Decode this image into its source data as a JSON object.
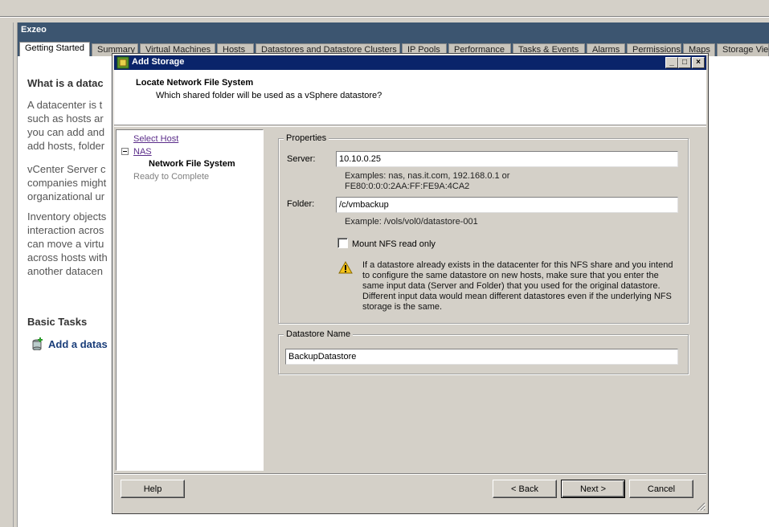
{
  "background": {
    "title": "Exzeo",
    "tabs": [
      "Getting Started",
      "Summary",
      "Virtual Machines",
      "Hosts",
      "Datastores and Datastore Clusters",
      "IP Pools",
      "Performance",
      "Tasks & Events",
      "Alarms",
      "Permissions",
      "Maps",
      "Storage Views"
    ],
    "heading": "What is a datac",
    "para1": [
      "A datacenter is t",
      "such as hosts ar",
      "you can add and",
      "add hosts, folder"
    ],
    "para2": [
      "vCenter Server c",
      "companies might",
      "organizational ur"
    ],
    "para3": [
      "Inventory objects",
      "interaction acros",
      "can move a virtu",
      "across hosts with",
      "another datacen"
    ],
    "basic_tasks": "Basic Tasks",
    "task_add": "Add a datas"
  },
  "dialog": {
    "title": "Add Storage",
    "header_title": "Locate Network File System",
    "header_subtitle": "Which shared folder will be used as a vSphere datastore?",
    "steps": {
      "select_host": "Select Host",
      "nas": "NAS",
      "nfs": "Network File System",
      "ready": "Ready to Complete"
    },
    "properties": {
      "legend": "Properties",
      "server_label": "Server:",
      "server_value": "10.10.0.25",
      "server_hint_1": "Examples: nas, nas.it.com, 192.168.0.1 or",
      "server_hint_2": "FE80:0:0:0:2AA:FF:FE9A:4CA2",
      "folder_label": "Folder:",
      "folder_value": "/c/vmbackup",
      "folder_hint": "Example: /vols/vol0/datastore-001",
      "mount_ro": "Mount NFS read only",
      "warning_1": "If a datastore already exists in the datacenter for this NFS share and you intend",
      "warning_2": "to configure the same datastore on new hosts, make sure that you enter the",
      "warning_3": "same input data (Server and Folder) that you used for the original datastore.",
      "warning_4": "Different input data would mean different datastores even if the underlying NFS",
      "warning_5": "storage is the same."
    },
    "datastore": {
      "legend": "Datastore Name",
      "value": "BackupDatastore"
    },
    "buttons": {
      "help": "Help",
      "back": "< Back",
      "next": "Next >",
      "cancel": "Cancel"
    }
  },
  "colors": {
    "titlebar": "#0a246a",
    "header_bg": "#3c5570",
    "link": "#5b2d8a"
  }
}
